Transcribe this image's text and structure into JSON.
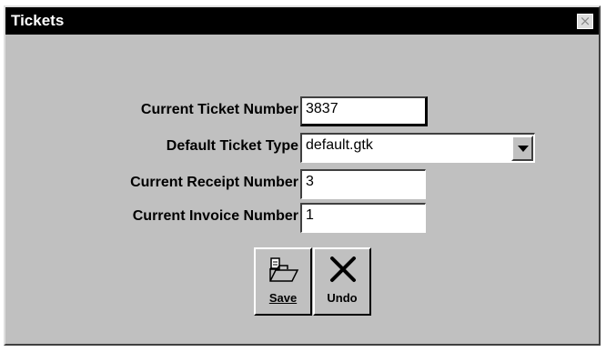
{
  "window": {
    "title": "Tickets",
    "close_label": "×"
  },
  "form": {
    "current_ticket_number": {
      "label": "Current Ticket Number",
      "value": "3837"
    },
    "default_ticket_type": {
      "label": "Default Ticket Type",
      "value": "default.gtk"
    },
    "current_receipt_number": {
      "label": "Current Receipt Number",
      "value": "3"
    },
    "current_invoice_number": {
      "label": "Current Invoice Number",
      "value": "1"
    }
  },
  "toolbar": {
    "save_label": "Save",
    "undo_label": "Undo",
    "save_icon": "open-folder-icon",
    "undo_icon": "undo-x-icon"
  }
}
